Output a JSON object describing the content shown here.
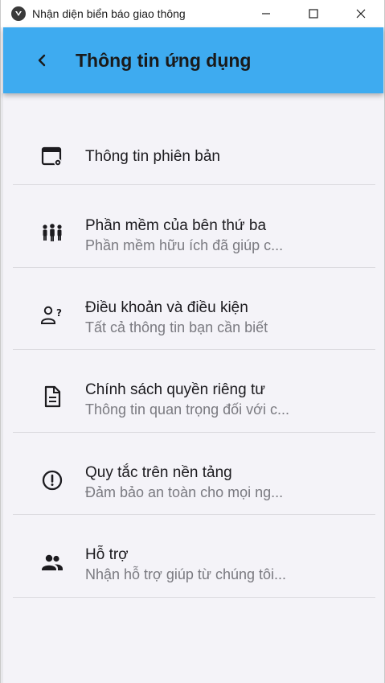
{
  "window": {
    "title": "Nhận diện biển báo giao thông",
    "icons": [
      "app-logo-icon",
      "minimize-icon",
      "maximize-icon",
      "close-icon"
    ]
  },
  "appbar": {
    "title": "Thông tin ứng dụng",
    "back_icon": "back-arrow-icon",
    "color": "#3eabf0"
  },
  "items": [
    {
      "title": "Thông tin phiên bản",
      "subtitle": "",
      "icon": "app-settings-icon"
    },
    {
      "title": "Phần mềm của bên thứ ba",
      "subtitle": "Phần mềm hữu ích đã giúp c...",
      "icon": "group-icon"
    },
    {
      "title": "Điều khoản và điều kiện",
      "subtitle": "Tất cả thông tin bạn cần biết",
      "icon": "person-question-icon"
    },
    {
      "title": "Chính sách quyền riêng tư",
      "subtitle": "Thông tin quan trọng đối với c...",
      "icon": "document-icon"
    },
    {
      "title": "Quy tắc trên nền tảng",
      "subtitle": "Đảm bảo an toàn cho mọi ng...",
      "icon": "alert-circle-icon"
    },
    {
      "title": "Hỗ trợ",
      "subtitle": "Nhận hỗ trợ giúp  từ chúng tôi...",
      "icon": "people-icon"
    }
  ]
}
